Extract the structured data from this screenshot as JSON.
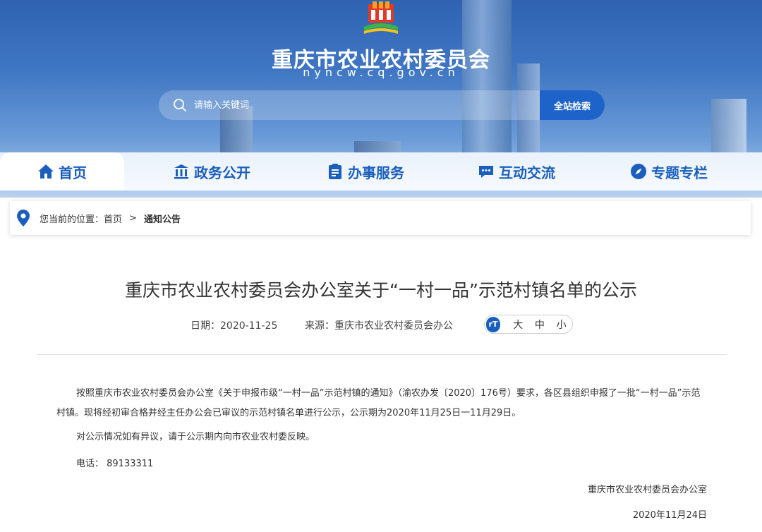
{
  "site": {
    "title": "重庆市农业农村委员会",
    "domain": "nyncw.cq.gov.cn"
  },
  "search": {
    "placeholder": "请输入关键词",
    "button_label": "全站检索"
  },
  "nav": {
    "items": [
      {
        "label": "首页",
        "icon": "home-icon"
      },
      {
        "label": "政务公开",
        "icon": "government-icon"
      },
      {
        "label": "办事服务",
        "icon": "clipboard-icon"
      },
      {
        "label": "互动交流",
        "icon": "chat-icon"
      },
      {
        "label": "专题专栏",
        "icon": "compass-icon"
      }
    ]
  },
  "breadcrumb": {
    "prefix": "您当前的位置：",
    "home": "首页",
    "separator": ">",
    "current": "通知公告"
  },
  "article": {
    "title": "重庆市农业农村委员会办公室关于“一村一品”示范村镇名单的公示",
    "date_label": "日期：",
    "date": "2020-11-25",
    "source_label": "来源：",
    "source": "重庆市农业农村委员会办公",
    "font_sizes": [
      "大",
      "中",
      "小"
    ],
    "font_icon_text": "rT",
    "paragraphs": [
      "按照重庆市农业农村委员会办公室《关于申报市级“一村一品”示范村镇的通知》（渝农办发〔2020〕176号）要求，各区县组织申报了一批“一村一品”示范村镇。现将经初审合格并经主任办公会已审议的示范村镇名单进行公示，公示期为2020年11月25日一11月29日。",
      "对公示情况如有异议，请于公示期内向市农业农村委反映。",
      "电话： 89133311"
    ],
    "signature": "重庆市农业农村委员会办公室",
    "sign_date": "2020年11月24日"
  },
  "colors": {
    "brand_blue": "#1b5fbd",
    "search_button": "#1e63c9"
  }
}
